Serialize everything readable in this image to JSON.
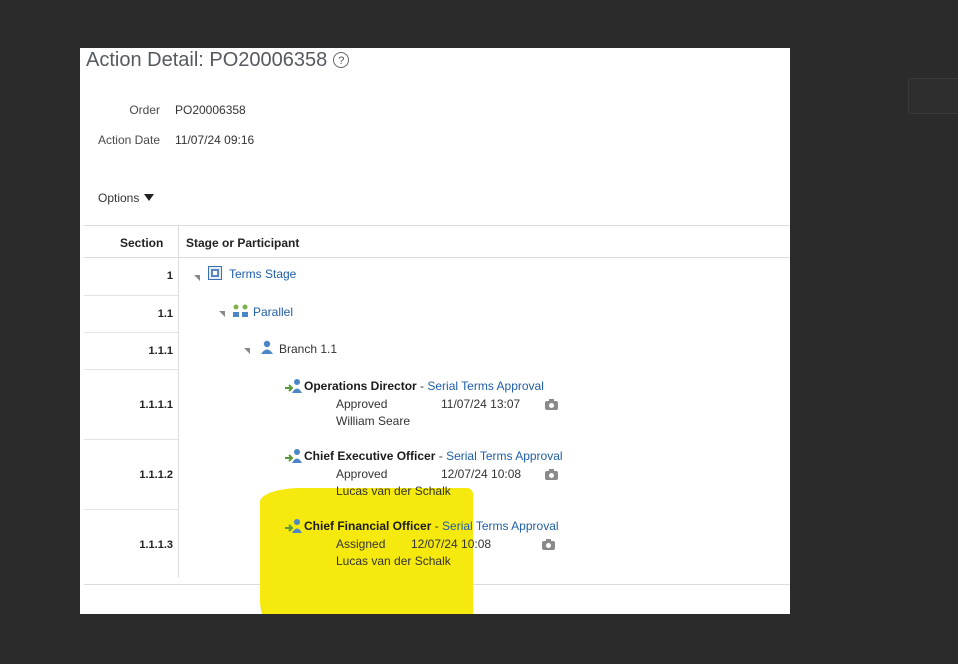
{
  "page": {
    "title": "Action Detail: PO20006358",
    "help_icon": "?",
    "order_label": "Order",
    "order_value": "PO20006358",
    "action_date_label": "Action Date",
    "action_date_value": "11/07/24 09:16",
    "options_label": "Options"
  },
  "table": {
    "headers": {
      "section": "Section",
      "stage": "Stage or Participant"
    },
    "rows": [
      {
        "section": "1",
        "label": "Terms Stage",
        "icon": "stage-icon"
      },
      {
        "section": "1.1",
        "label": "Parallel",
        "icon": "parallel-icon"
      },
      {
        "section": "1.1.1",
        "label": "Branch 1.1",
        "icon": "branch-icon"
      },
      {
        "section": "1.1.1.1",
        "role": "Operations Director",
        "sep": " - ",
        "approval": "Serial Terms Approval",
        "status": "Approved",
        "date": "11/07/24 13:07",
        "person": "William Seare",
        "icon": "participant-icon"
      },
      {
        "section": "1.1.1.2",
        "role": "Chief Executive Officer",
        "sep": " - ",
        "approval": "Serial Terms Approval",
        "status": "Approved",
        "date": "12/07/24 10:08",
        "person": "Lucas van der Schalk",
        "icon": "participant-icon"
      },
      {
        "section": "1.1.1.3",
        "role": "Chief Financial Officer",
        "sep": " - ",
        "approval": "Serial Terms Approval",
        "status": "Assigned",
        "date": "12/07/24 10:08",
        "person": "Lucas van der Schalk",
        "icon": "participant-icon"
      }
    ]
  },
  "colors": {
    "link": "#1f5ea8",
    "highlight": "#f5e800",
    "background": "#2b2b2b"
  }
}
